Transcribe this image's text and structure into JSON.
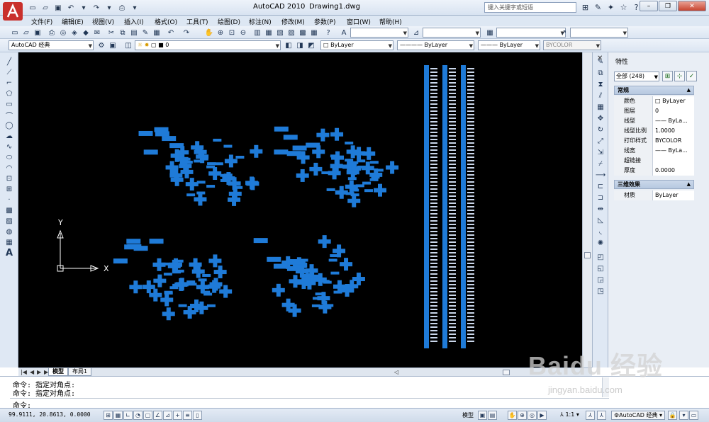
{
  "titlebar": {
    "app_title": "AutoCAD 2010",
    "doc_title": "Drawing1.dwg",
    "search_placeholder": "键入关键字或短语"
  },
  "menu": [
    "文件(F)",
    "编辑(E)",
    "视图(V)",
    "插入(I)",
    "格式(O)",
    "工具(T)",
    "绘图(D)",
    "标注(N)",
    "修改(M)",
    "参数(P)",
    "窗口(W)",
    "帮助(H)"
  ],
  "workspace": {
    "value": "AutoCAD 经典"
  },
  "layer": {
    "value": "0"
  },
  "properties_toolbar": {
    "color": "ByLayer",
    "linetype": "ByLayer",
    "lineweight": "ByLayer",
    "plotstyle": "BYCOLOR"
  },
  "palette": {
    "title": "特性",
    "selection": "全部 (248)",
    "sections": [
      {
        "name": "常规",
        "rows": [
          {
            "key": "颜色",
            "value": "ByLayer"
          },
          {
            "key": "图层",
            "value": "0"
          },
          {
            "key": "线型",
            "value": "—— ByLa..."
          },
          {
            "key": "线型比例",
            "value": "1.0000"
          },
          {
            "key": "打印样式",
            "value": "BYCOLOR"
          },
          {
            "key": "线宽",
            "value": "—— ByLa..."
          },
          {
            "key": "超链接",
            "value": ""
          },
          {
            "key": "厚度",
            "value": "0.0000"
          }
        ]
      },
      {
        "name": "三维效果",
        "rows": [
          {
            "key": "材质",
            "value": "ByLayer"
          }
        ]
      }
    ]
  },
  "ucs": {
    "x_label": "X",
    "y_label": "Y"
  },
  "layout_tabs": [
    "模型",
    "布局1"
  ],
  "command": {
    "history": [
      "命令: 指定对角点:",
      "命令: 指定对角点:"
    ],
    "prompt": "命令:"
  },
  "status": {
    "coords": "99.9111, 20.8613, 0.0000",
    "model_label": "模型",
    "scale": "1:1",
    "workspace": "AutoCAD 经典"
  },
  "watermark": {
    "main": "Baidu 经验",
    "sub": "jingyan.baidu.com"
  },
  "colors": {
    "selection_blue": "#1f7bd8",
    "canvas_bg": "#000000"
  }
}
